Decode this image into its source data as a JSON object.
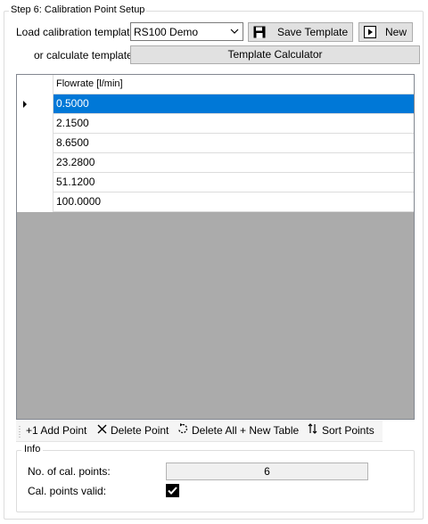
{
  "group": {
    "title": "Step 6: Calibration Point Setup"
  },
  "template": {
    "load_label": "Load calibration template:",
    "selected": "RS100 Demo",
    "save_label": "Save Template",
    "new_label": "New",
    "calc_label": "or calculate template:",
    "calc_button": "Template Calculator"
  },
  "grid": {
    "column_header": "Flowrate [l/min]",
    "rows": [
      "0.5000",
      "2.1500",
      "8.6500",
      "23.2800",
      "51.1200",
      "100.0000"
    ],
    "selected_row": 0
  },
  "toolbar": {
    "add_label": "+1 Add Point",
    "delete_label": "Delete Point",
    "delete_all_label": "Delete All + New Table",
    "sort_label": "Sort Points"
  },
  "info": {
    "title": "Info",
    "count_label": "No. of cal. points:",
    "count_value": "6",
    "valid_label": "Cal. points valid:",
    "valid_checked": true
  },
  "colors": {
    "selection": "#0078d7",
    "grid_background": "#ababab",
    "button": "#e1e1e1"
  }
}
